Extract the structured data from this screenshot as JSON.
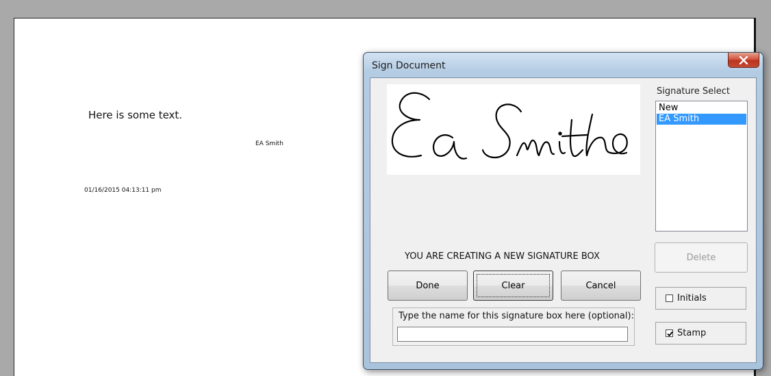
{
  "document": {
    "body_text": "Here is some text.",
    "signer_name": "EA Smith",
    "timestamp": "01/16/2015 04:13:11 pm"
  },
  "dialog": {
    "title": "Sign Document",
    "signature_select_label": "Signature Select",
    "signature_list": [
      {
        "label": "New",
        "selected": false
      },
      {
        "label": "EA Smith",
        "selected": true
      }
    ],
    "status_message": "YOU ARE CREATING A NEW SIGNATURE BOX",
    "buttons": {
      "done": {
        "label": "Done",
        "mnemonic": "D"
      },
      "clear": {
        "label": "Clear",
        "mnemonic": "e"
      },
      "cancel": {
        "label": "Cancel",
        "mnemonic": "C"
      },
      "delete": {
        "label": "Delete",
        "mnemonic": "l",
        "enabled": false
      }
    },
    "name_prompt": "Type the name for this signature box here (optional):",
    "name_value": "",
    "initials": {
      "label": "Initials",
      "checked": false
    },
    "stamp": {
      "label": "Stamp",
      "checked": true
    },
    "signature_image": {
      "handwriting": "Ea Smith"
    },
    "close_icon": "close-icon",
    "colors": {
      "selection": "#3399ff",
      "close_button": "#c54a35"
    }
  }
}
